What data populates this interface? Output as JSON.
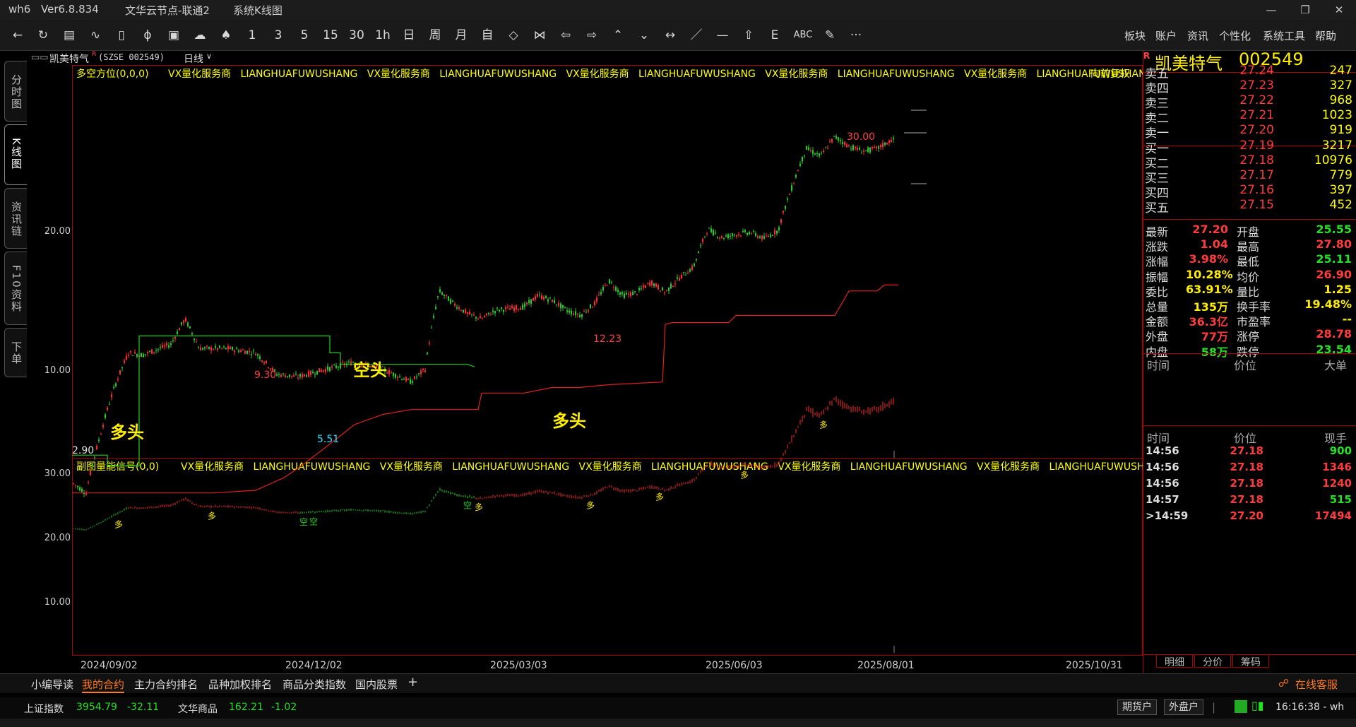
{
  "app": {
    "title": "wh6",
    "version": "Ver6.8.834",
    "server": "文华云节点-联通2",
    "view": "系统K线图"
  },
  "window_controls": [
    "—",
    "❐",
    "✕"
  ],
  "toolbar": {
    "icons": [
      "back-icon",
      "refresh-icon",
      "table-icon",
      "line-chart-icon",
      "kline-icon",
      "tick-icon",
      "window-icon",
      "cloud-icon",
      "bell-icon"
    ],
    "periods": [
      "1",
      "3",
      "5",
      "15",
      "30",
      "1h",
      "日",
      "周",
      "月",
      "自"
    ],
    "tools": [
      "◇",
      "⋈",
      "⇦",
      "⇨",
      "⌃",
      "⌄",
      "↔",
      "／",
      "—",
      "⇧",
      "E",
      "ABC",
      "✎",
      "···"
    ],
    "menus": [
      "板块",
      "账户",
      "资讯",
      "个性化",
      "系统工具",
      "帮助"
    ]
  },
  "left_tabs": [
    {
      "label": "分时图",
      "active": false
    },
    {
      "label": "K线图",
      "active": true
    },
    {
      "label": "资讯链",
      "active": false
    },
    {
      "label": "F10资料",
      "active": false
    },
    {
      "label": "下单",
      "active": false
    }
  ],
  "info_bar": {
    "name": "凯美特气",
    "badge": "R",
    "code": "(SZSE  002549)",
    "period": "日线"
  },
  "main_chart": {
    "indicator": "多空方位(0,0,0)",
    "ad_text": "VX量化服务商   LIANGHUAFUWUSHANG   VX量化服务商   LIANGHUAFUWUSHANG   VX量化服务商   LIANGHUAFUWUSHANG   VX量化服务商   LIANGHUAFUWUSHANG   VX量化服务商   LIANGHUAFUWUSHANG",
    "adjust": "向前复权",
    "y_ticks": [
      "20.00",
      "10.00"
    ],
    "labels": {
      "high1": "9.30",
      "high2": "12.23",
      "high3": "30.00",
      "low1": "5.51",
      "low0": "2.90"
    },
    "signals": {
      "duo1": "多头",
      "kong": "空头",
      "duo2": "多头"
    }
  },
  "sub_chart": {
    "indicator": "副图量能信号(0,0)",
    "ad_text": "VX量化服务商   LIANGHUAFUWUSHANG   VX量化服务商   LIANGHUAFUWUSHANG   VX量化服务商   LIANGHUAFUWUSHANG   VX量化服务商   LIANGHUAFUWUSHANG   VX量化服务商   LIANGHUAFUWUSHANG",
    "y_ticks": [
      "30.00",
      "20.00",
      "10.00"
    ],
    "markers": [
      "多",
      "多",
      "空",
      "空",
      "空",
      "多",
      "多",
      "多",
      "多",
      "多"
    ]
  },
  "x_axis": [
    "2024/09/02",
    "2024/12/02",
    "2025/03/03",
    "2025/06/03",
    "2025/08/01",
    "2025/10/31"
  ],
  "quote": {
    "name": "凯美特气",
    "code": "002549",
    "asks": [
      {
        "label": "卖五",
        "price": "27.24",
        "vol": "247"
      },
      {
        "label": "卖四",
        "price": "27.23",
        "vol": "327"
      },
      {
        "label": "卖三",
        "price": "27.22",
        "vol": "968"
      },
      {
        "label": "卖二",
        "price": "27.21",
        "vol": "1023"
      },
      {
        "label": "卖一",
        "price": "27.20",
        "vol": "919"
      }
    ],
    "bids": [
      {
        "label": "买一",
        "price": "27.19",
        "vol": "3217"
      },
      {
        "label": "买二",
        "price": "27.18",
        "vol": "10976"
      },
      {
        "label": "买三",
        "price": "27.17",
        "vol": "779"
      },
      {
        "label": "买四",
        "price": "27.16",
        "vol": "397"
      },
      {
        "label": "买五",
        "price": "27.15",
        "vol": "452"
      }
    ],
    "stats": [
      {
        "l": "最新",
        "v": "27.20",
        "c": "red",
        "l2": "开盘",
        "v2": "25.55",
        "c2": "green"
      },
      {
        "l": "涨跌",
        "v": "1.04",
        "c": "red",
        "l2": "最高",
        "v2": "27.80",
        "c2": "red"
      },
      {
        "l": "涨幅",
        "v": "3.98%",
        "c": "red",
        "l2": "最低",
        "v2": "25.11",
        "c2": "green"
      },
      {
        "l": "振幅",
        "v": "10.28%",
        "c": "yel",
        "l2": "均价",
        "v2": "26.90",
        "c2": "red"
      },
      {
        "l": "委比",
        "v": "63.91%",
        "c": "yel",
        "l2": "量比",
        "v2": "1.25",
        "c2": "yel"
      },
      {
        "l": "总量",
        "v": "135万",
        "c": "yel",
        "l2": "换手率",
        "v2": "19.48%",
        "c2": "yel"
      },
      {
        "l": "金额",
        "v": "36.3亿",
        "c": "red",
        "l2": "市盈率",
        "v2": "--",
        "c2": "yel"
      },
      {
        "l": "外盘",
        "v": "77万",
        "c": "red",
        "l2": "涨停",
        "v2": "28.78",
        "c2": "red"
      },
      {
        "l": "内盘",
        "v": "58万",
        "c": "green",
        "l2": "跌停",
        "v2": "23.54",
        "c2": "green"
      }
    ],
    "big_header": {
      "time": "时间",
      "price": "价位",
      "big": "大单"
    },
    "tick_header": {
      "time": "时间",
      "price": "价位",
      "vol": "现手"
    },
    "ticks": [
      {
        "t": "14:56",
        "p": "27.18",
        "v": "900",
        "c": "green"
      },
      {
        "t": "14:56",
        "p": "27.18",
        "v": "1346",
        "c": "red"
      },
      {
        "t": "14:56",
        "p": "27.18",
        "v": "1240",
        "c": "red"
      },
      {
        "t": "14:57",
        "p": "27.18",
        "v": "515",
        "c": "green"
      },
      {
        "t": ">14:59",
        "p": "27.20",
        "v": "17494",
        "c": "red"
      }
    ],
    "tabs": [
      "明细",
      "分价",
      "筹码"
    ]
  },
  "bottom_tabs": [
    "小编导读",
    "我的合约",
    "主力合约排名",
    "品种加权排名",
    "商品分类指数",
    "国内股票",
    "+"
  ],
  "active_bottom_tab": "我的合约",
  "service": "在线客服",
  "status": {
    "idx1_name": "上证指数",
    "idx1_val": "3954.79",
    "idx1_chg": "-32.11",
    "idx2_name": "文华商品",
    "idx2_val": "162.21",
    "idx2_chg": "-1.02",
    "btn1": "期货户",
    "btn2": "外盘户",
    "time": "16:16:38 - wh"
  }
}
